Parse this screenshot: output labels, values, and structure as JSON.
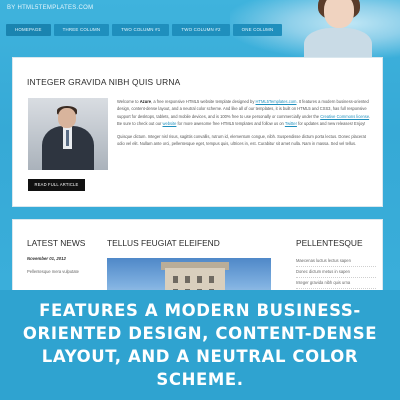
{
  "site": {
    "url": "BY HTML5TEMPLATES.COM"
  },
  "nav": {
    "items": [
      "HOMEPAGE",
      "THREE COLUMN",
      "TWO COLUMN #1",
      "TWO COLUMN #2",
      "ONE COLUMN"
    ]
  },
  "main": {
    "title": "INTEGER GRAVIDA NIBH QUIS URNA",
    "para1": {
      "lead": "Welcome to ",
      "brand": "Azure",
      "t1": ", a free responsive HTML5 website template designed by ",
      "link1": "HTML5Templates.com",
      "t2": ". It features a modern business-oriented design, content-dense layout, and a neutral color scheme. And like all of our templates, it is built on HTML5 and CSS3, has full responsive support for desktops, tablets, and mobile devices, and is 100% free to use personally or commercially under the ",
      "link2": "Creative Commons license",
      "t3": ". Be sure to check out our ",
      "link3": "website",
      "t4": " for more awesome free HTML5 templates and follow us on ",
      "link4": "Twitter",
      "t5": " for updates and new releases! Enjoy!"
    },
    "para2": "Quisque dictum. Integer nisl risus, sagittis convallis, rutrum id, elementum congue, nibh. Suspendisse dictum porta lectus. Donec placerat odio vel elit. Nullam ante orci, pellentesque eget, tempus quis, ultrices in, est. Curabitur sit amet nulla. Nam in massa. Sed vel tellus.",
    "read_button": "READ FULL ARTICLE"
  },
  "lower": {
    "latest_title": "LATEST NEWS",
    "news_date": "November 01, 2012",
    "news_text": "Pellentesque mera vulputate",
    "featured_title": "TELLUS FEUGIAT ELEIFEND",
    "pell_title": "PELLENTESQUE",
    "pell_items": [
      "Maecenas luctus lectus sapen",
      "Donec dictum metus in sapen",
      "Integer gravida nibh quis urna"
    ]
  },
  "caption": "FEATURES A MODERN BUSINESS-ORIENTED DESIGN, CONTENT-DENSE LAYOUT, AND A NEUTRAL COLOR SCHEME.",
  "colors": {
    "accent": "#2fa3d0",
    "nav_bg": "#1f8fbd",
    "button_bg": "#111111"
  },
  "icons": []
}
